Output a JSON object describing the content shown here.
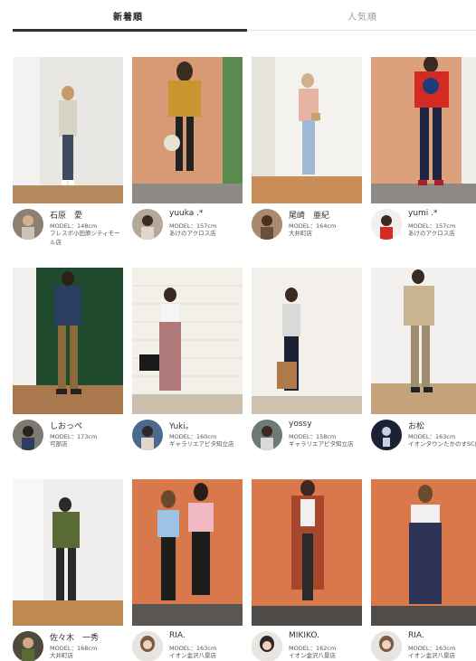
{
  "tabs": [
    {
      "label": "新着順",
      "active": true
    },
    {
      "label": "人気順",
      "active": false
    }
  ],
  "colors": {
    "active_tab": "#333333",
    "inactive_tab": "#999999",
    "divider": "#e4e4e4"
  },
  "staff": [
    {
      "name": "石原　愛",
      "model": "MODEL：148cm",
      "store": "フレスポ小田原シティモール店"
    },
    {
      "name": "yuuka .*",
      "model": "MODEL：157cm",
      "store": "あけのアクロス店"
    },
    {
      "name": "尾崎　亜紀",
      "model": "MODEL：164cm",
      "store": "大井町店"
    },
    {
      "name": "yumi .*",
      "model": "MODEL：157cm",
      "store": "あけのアクロス店"
    },
    {
      "name": "しおっぺ",
      "model": "MODEL：173cm",
      "store": "可部店"
    },
    {
      "name": "Yuki。",
      "model": "MODEL：160cm",
      "store": "ギャラリエアピタ知立店"
    },
    {
      "name": "yossy",
      "model": "MODEL：158cm",
      "store": "ギャラリエアピタ知立店"
    },
    {
      "name": "お松",
      "model": "MODEL：163cm",
      "store": "イオンタウンたかのすSC店"
    },
    {
      "name": "佐々木　一秀",
      "model": "MODEL：168cm",
      "store": "大井町店"
    },
    {
      "name": "RIA.",
      "model": "MODEL：163cm",
      "store": "イオン金沢八景店"
    },
    {
      "name": "MIKIKO.",
      "model": "MODEL：162cm",
      "store": "イオン金沢八景店"
    },
    {
      "name": "RIA.",
      "model": "MODEL：163cm",
      "store": "イオン金沢八景店"
    }
  ]
}
